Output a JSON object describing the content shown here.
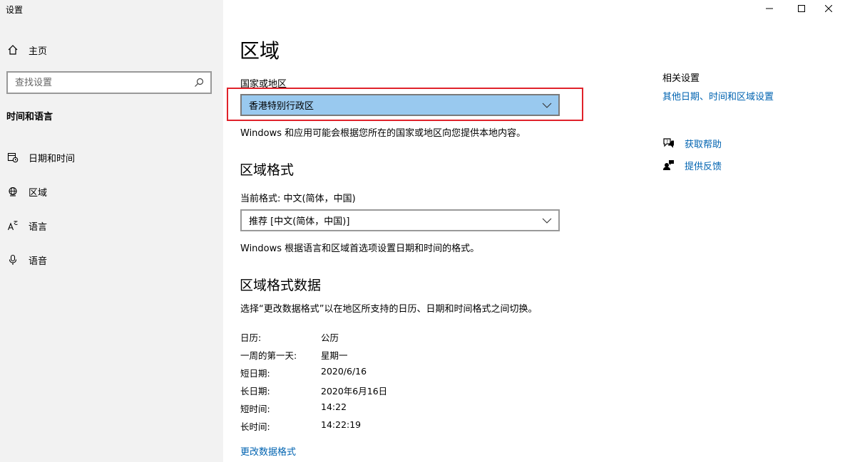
{
  "app": {
    "title": "设置"
  },
  "sidebar": {
    "home_label": "主页",
    "search_placeholder": "查找设置",
    "section_title": "时间和语言",
    "items": [
      {
        "label": "日期和时间",
        "icon": "calendar-clock-icon"
      },
      {
        "label": "区域",
        "icon": "globe-icon"
      },
      {
        "label": "语言",
        "icon": "language-icon"
      },
      {
        "label": "语音",
        "icon": "microphone-icon"
      }
    ]
  },
  "main": {
    "title": "区域",
    "country": {
      "label": "国家或地区",
      "selected": "香港特别行政区",
      "description": "Windows 和应用可能会根据您所在的国家或地区向您提供本地内容。"
    },
    "format": {
      "heading": "区域格式",
      "current_label": "当前格式: 中文(简体，中国)",
      "selected": "推荐 [中文(简体，中国)]",
      "description": "Windows 根据语言和区域首选项设置日期和时间的格式。"
    },
    "format_data": {
      "heading": "区域格式数据",
      "description": "选择“更改数据格式”以在地区所支持的日历、日期和时间格式之间切换。",
      "rows": [
        {
          "label": "日历:",
          "value": "公历"
        },
        {
          "label": "一周的第一天:",
          "value": "星期一"
        },
        {
          "label": "短日期:",
          "value": "2020/6/16"
        },
        {
          "label": "长日期:",
          "value": "2020年6月16日"
        },
        {
          "label": "短时间:",
          "value": "14:22"
        },
        {
          "label": "长时间:",
          "value": "14:22:19"
        }
      ],
      "change_link": "更改数据格式"
    }
  },
  "related": {
    "title": "相关设置",
    "link": "其他日期、时间和区域设置",
    "help_label": "获取帮助",
    "feedback_label": "提供反馈"
  },
  "colors": {
    "accent_link": "#0063b1",
    "selected_dropdown": "#99c9ef",
    "highlight_border": "#e0222a",
    "sidebar_bg": "#f2f2f2"
  }
}
